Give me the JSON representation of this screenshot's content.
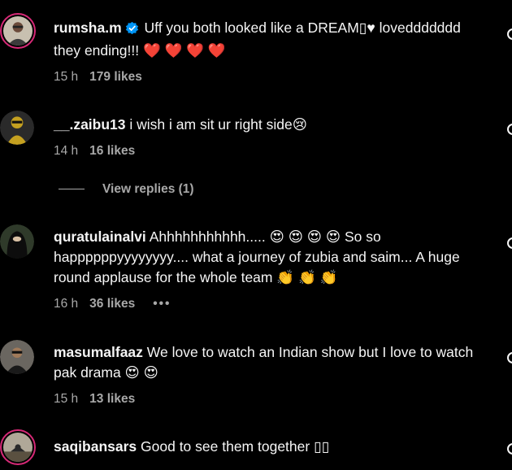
{
  "comments": [
    {
      "username": "rumsha.m",
      "verified": true,
      "text": "Uff you both looked like a DREAM▯♥ loveddddddd they ending!!! ❤️ ❤️ ❤️ ❤️",
      "time": "15 h",
      "likes": "179 likes",
      "avatar_icon": "user-avatar-icon",
      "colors": {
        "avatar_bg": "#c8c0b0"
      }
    },
    {
      "username": "__.zaibu13",
      "verified": false,
      "text": "i wish i am sit ur right side😢",
      "time": "14 h",
      "likes": "16 likes",
      "avatar_icon": "user-avatar-icon",
      "colors": {
        "avatar_bg": "#c4a020"
      }
    },
    {
      "username": "quratulainalvi",
      "verified": false,
      "text": "Ahhhhhhhhhhh..... 😍 😍 😍 😍  So so happppppyyyyyyyy.... what a journey of zubia and saim... A huge round applause for the whole team 👏 👏 👏",
      "time": "16 h",
      "likes": "36 likes",
      "more": "•••",
      "avatar_icon": "user-avatar-icon",
      "colors": {
        "avatar_bg": "#2f3a2a"
      }
    },
    {
      "username": "masumalfaaz",
      "verified": false,
      "text": "We love to watch an Indian show but I love to watch pak drama 😍 😍",
      "time": "15 h",
      "likes": "13 likes",
      "avatar_icon": "user-avatar-icon",
      "colors": {
        "avatar_bg": "#6a6660"
      }
    },
    {
      "username": "saqibansars",
      "verified": false,
      "text": "Good to see them together ▯▯",
      "avatar_icon": "user-avatar-icon",
      "colors": {
        "avatar_bg": "#b0a898"
      }
    }
  ],
  "view_replies": "View replies (1)",
  "colors": {
    "accent_verified": "#0095f6",
    "story_ring": "#d62976",
    "muted": "#a8a8a8"
  }
}
